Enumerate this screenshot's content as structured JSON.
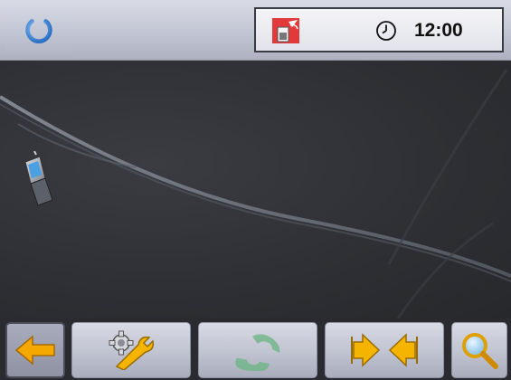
{
  "status_bar": {
    "time": "12:00",
    "icons": {
      "power": "power-icon",
      "card": "memory-card-icon",
      "clock": "clock-icon"
    }
  },
  "map": {
    "icons": {
      "device": "mobile-phone-icon"
    }
  },
  "toolbar": {
    "buttons": [
      {
        "icon": "back-arrow-icon",
        "state": "pressed"
      },
      {
        "icon": "settings-tools-icon"
      },
      {
        "icon": "phone-handset-icon",
        "state": "disabled"
      },
      {
        "icon": "route-merge-icon"
      },
      {
        "icon": "search-icon"
      }
    ]
  },
  "colors": {
    "accent_orange": "#f5a800",
    "power_blue": "#3a86d8",
    "phone_green": "#6fb587",
    "map_background": "#2f3136"
  }
}
